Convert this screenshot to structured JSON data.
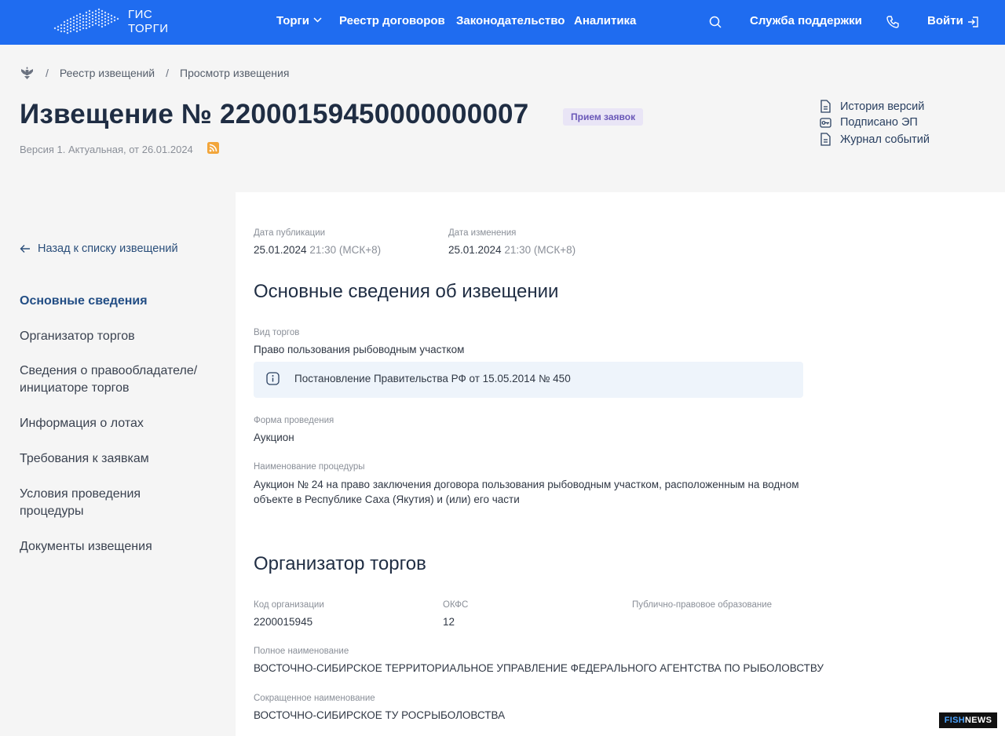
{
  "header": {
    "logo_line1": "ГИС",
    "logo_line2": "ТОРГИ",
    "nav": [
      {
        "label": "Торги"
      },
      {
        "label": "Реестр договоров"
      },
      {
        "label": "Законодательство"
      },
      {
        "label": "Аналитика"
      }
    ],
    "support_label": "Служба поддержки",
    "login_label": "Войти",
    "icons": [
      "search-icon",
      "phone-icon",
      "login-icon",
      "chevron-down-icon"
    ]
  },
  "breadcrumb": {
    "items": [
      "Реестр извещений",
      "Просмотр извещения"
    ],
    "separator": "/"
  },
  "notice": {
    "title": "Извещение № 22000159450000000007",
    "status": "Прием заявок",
    "version": "Версия 1. Актуальная, от 26.01.2024"
  },
  "side_links": [
    {
      "label": "История версий",
      "icon": "document-icon"
    },
    {
      "label": "Подписано ЭП",
      "icon": "key-icon"
    },
    {
      "label": "Журнал событий",
      "icon": "document-icon"
    }
  ],
  "sidebar": {
    "back_label": "Назад к списку извещений",
    "items": [
      {
        "label": "Основные сведения",
        "active": true
      },
      {
        "label": "Организатор торгов"
      },
      {
        "label": "Сведения о правообладателе/ инициаторе торгов"
      },
      {
        "label": "Информация о лотах"
      },
      {
        "label": "Требования к заявкам"
      },
      {
        "label": "Условия проведения процедуры"
      },
      {
        "label": "Документы извещения"
      }
    ]
  },
  "dates": {
    "published_label": "Дата публикации",
    "published_date": "25.01.2024",
    "published_time": "21:30 (МСК+8)",
    "changed_label": "Дата изменения",
    "changed_date": "25.01.2024",
    "changed_time": "21:30 (МСК+8)"
  },
  "main_info": {
    "heading": "Основные сведения об извещении",
    "trade_type_label": "Вид торгов",
    "trade_type_value": "Право пользования рыбоводным участком",
    "info_note": "Постановление Правительства РФ от 15.05.2014 № 450",
    "form_label": "Форма проведения",
    "form_value": "Аукцион",
    "procedure_label": "Наименование процедуры",
    "procedure_value": "Аукцион № 24 на право заключения договора пользования рыбоводным участком, расположенным на водном объекте в Республике Саха (Якутия) и (или) его части"
  },
  "organizer": {
    "heading": "Организатор торгов",
    "code_label": "Код организации",
    "code_value": "2200015945",
    "okfs_label": "ОКФС",
    "okfs_value": "12",
    "ppo_label": "Публично-правовое образование",
    "full_name_label": "Полное наименование",
    "full_name_value": "ВОСТОЧНО-СИБИРСКОЕ ТЕРРИТОРИАЛЬНОЕ УПРАВЛЕНИЕ ФЕДЕРАЛЬНОГО АГЕНТСТВА ПО РЫБОЛОВСТВУ",
    "short_name_label": "Сокращенное наименование",
    "short_name_value": "ВОСТОЧНО-СИБИРСКОЕ ТУ РОСРЫБОЛОВСТВА"
  },
  "watermark": {
    "part1": "FISH",
    "part2": "NEWS"
  },
  "colors": {
    "brand_blue": "#1f6cf0",
    "badge_bg": "#e9e5f6",
    "badge_text": "#6a58b8",
    "active_nav": "#234e85"
  }
}
